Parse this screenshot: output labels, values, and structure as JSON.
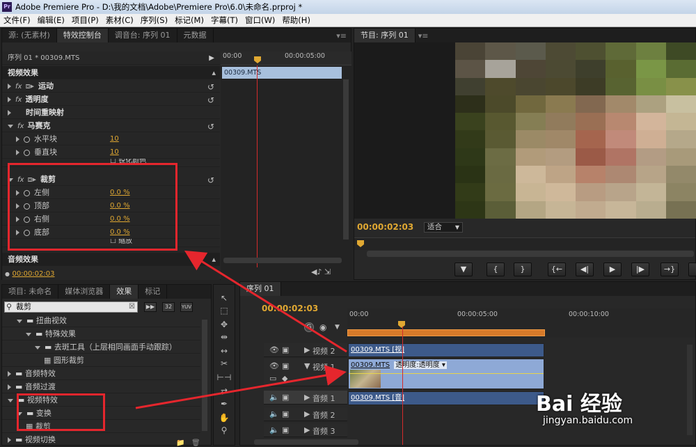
{
  "window": {
    "title": "Adobe Premiere Pro - D:\\我的文档\\Adobe\\Premiere Pro\\6.0\\未命名.prproj *"
  },
  "menu": [
    "文件(F)",
    "编辑(E)",
    "项目(P)",
    "素材(C)",
    "序列(S)",
    "标记(M)",
    "字幕(T)",
    "窗口(W)",
    "帮助(H)"
  ],
  "effect_controls": {
    "tabs": [
      "源: (无素材)",
      "特效控制台",
      "调音台: 序列 01",
      "元数据"
    ],
    "header": "序列 01 * 00309.MTS",
    "video_effects_label": "视频效果",
    "effects": {
      "motion": "运动",
      "opacity": "透明度",
      "time_remap": "时间重映射",
      "mosaic": "马赛克",
      "h_blocks": "水平块",
      "h_blocks_val": "10",
      "v_blocks": "垂直块",
      "v_blocks_val": "10",
      "sharpen": "锐化颜色",
      "crop": "裁剪",
      "left": "左侧",
      "left_val": "0.0 %",
      "top": "顶部",
      "top_val": "0.0 %",
      "right": "右侧",
      "right_val": "0.0 %",
      "bottom": "底部",
      "bottom_val": "0.0 %",
      "zoom": "缩放"
    },
    "audio_effects_label": "音频效果",
    "timecode": "00:00:02:03",
    "ruler": [
      "00:00",
      "00:00:05:00"
    ],
    "clip_name": "00309.MTS"
  },
  "program_monitor": {
    "tab": "节目: 序列 01",
    "timecode": "00:00:02:03",
    "fit": "适合",
    "mosaic_colors": [
      "#4a4436",
      "#5d5748",
      "#5b5a4c",
      "#4d4a34",
      "#4e5031",
      "#5f6a38",
      "#6d8040",
      "#3e4a25",
      "#5c5446",
      "#a7a39a",
      "#4e4636",
      "#4c4a33",
      "#3e3f2c",
      "#59612f",
      "#7a9646",
      "#5a6c33",
      "#404030",
      "#4e4a2c",
      "#4a4630",
      "#4c482c",
      "#3d3c26",
      "#586331",
      "#798f44",
      "#88914a",
      "#2d2f1a",
      "#4c4a2a",
      "#71683e",
      "#8a7a50",
      "#826850",
      "#a2896a",
      "#aca180",
      "#c8c0a0",
      "#3a421e",
      "#585830",
      "#857e54",
      "#917b5c",
      "#9a6f54",
      "#b88870",
      "#d3b59b",
      "#c4b694",
      "#323a19",
      "#5a5a33",
      "#9b8a66",
      "#a08868",
      "#a5654e",
      "#c18a7a",
      "#cfaf94",
      "#b5a88a",
      "#2e3818",
      "#6c6c44",
      "#b19b7a",
      "#b39c80",
      "#9b5a47",
      "#b07464",
      "#b39c84",
      "#a89a7a",
      "#2a3315",
      "#6a6a42",
      "#cdb89a",
      "#bea486",
      "#b7826a",
      "#ad8872",
      "#b7a488",
      "#93896a",
      "#323b18",
      "#6b6b41",
      "#c8b594",
      "#cfb89a",
      "#b89c82",
      "#b8a48a",
      "#c3b597",
      "#8c8463",
      "#2d3616",
      "#5b5e38",
      "#b4a684",
      "#c6b596",
      "#c1ab8f",
      "#c7b699",
      "#b9ad8f",
      "#777153"
    ]
  },
  "project": {
    "tabs": [
      "项目: 未命名",
      "媒体浏览器",
      "效果",
      "标记"
    ],
    "search_value": "裁剪",
    "filters": [
      "32",
      "YUV"
    ],
    "tree": [
      {
        "label": "扭曲视效",
        "indent": 1
      },
      {
        "label": "特殊效果",
        "indent": 2
      },
      {
        "label": "去斑工具（上层相同画面手动跟踪）",
        "indent": 3
      },
      {
        "label": "圆形裁剪",
        "indent": 4
      },
      {
        "label": "音频特效",
        "indent": 0
      },
      {
        "label": "音频过渡",
        "indent": 0
      },
      {
        "label": "视频特效",
        "indent": 0
      },
      {
        "label": "变换",
        "indent": 1
      },
      {
        "label": "裁剪",
        "indent": 2
      },
      {
        "label": "视频切换",
        "indent": 0
      }
    ]
  },
  "timeline": {
    "tab": "序列 01",
    "timecode": "00:00:02:03",
    "ruler": [
      "00:00",
      "00:00:05:00",
      "00:00:10:00"
    ],
    "tracks": {
      "v2": "视频 2",
      "v1": "视频 1",
      "a1": "音频 1",
      "a2": "音频 2",
      "a3": "音频 3"
    },
    "clips": {
      "v2": "00309.MTS [视]",
      "v1": "00309.MTS",
      "v1_fx": "透明度:透明度 ▾",
      "a1": "00309.MTS [音]"
    }
  },
  "watermark": {
    "brand": "Bai 经验",
    "url": "jingyan.baidu.com"
  }
}
